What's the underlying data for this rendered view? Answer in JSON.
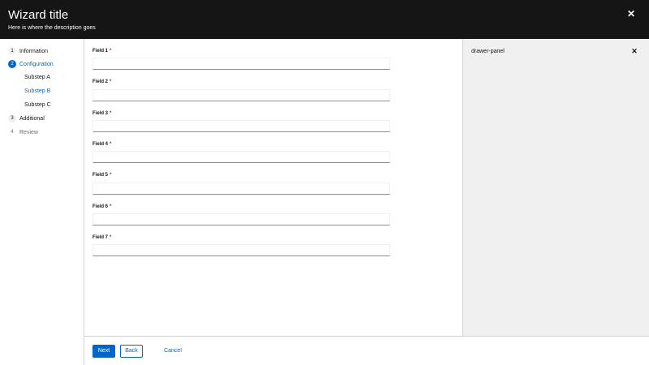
{
  "header": {
    "title": "Wizard title",
    "description": "Here is where the description goes",
    "close_icon": "close-icon"
  },
  "nav": {
    "items": [
      {
        "number": "1",
        "label": "Information",
        "state": "default"
      },
      {
        "number": "2",
        "label": "Configuration",
        "state": "current"
      },
      {
        "number": "3",
        "label": "Additional",
        "state": "default"
      },
      {
        "number": "4",
        "label": "Review",
        "state": "disabled"
      }
    ],
    "substeps": [
      {
        "label": "Substep A",
        "state": "default"
      },
      {
        "label": "Substep B",
        "state": "current"
      },
      {
        "label": "Substep C",
        "state": "default"
      }
    ]
  },
  "form": {
    "required_mark": "*",
    "fields": [
      {
        "label": "Field 1",
        "value": ""
      },
      {
        "label": "Field 2",
        "value": ""
      },
      {
        "label": "Field 3",
        "value": ""
      },
      {
        "label": "Field 4",
        "value": ""
      },
      {
        "label": "Field 5",
        "value": ""
      },
      {
        "label": "Field 6",
        "value": ""
      },
      {
        "label": "Field 7",
        "value": ""
      }
    ]
  },
  "drawer": {
    "title": "drawer-panel",
    "close_icon": "close-icon"
  },
  "footer": {
    "next_label": "Next",
    "back_label": "Back",
    "cancel_label": "Cancel"
  },
  "colors": {
    "accent": "#0066cc",
    "header_bg": "#151515",
    "required": "#c9190b",
    "drawer_bg": "#f0f0f0"
  }
}
